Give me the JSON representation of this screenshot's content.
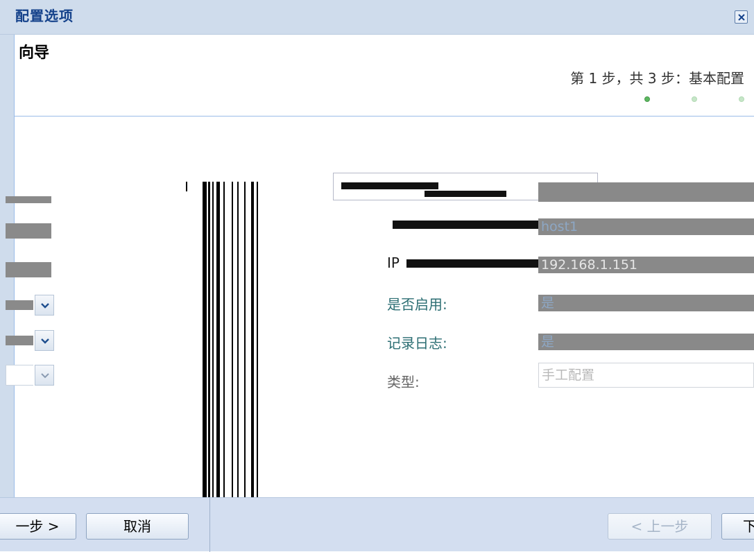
{
  "window": {
    "title": "配置选项",
    "close_icon": "close-icon"
  },
  "wizard": {
    "title": "向导",
    "step_text": "第 1 步，共 3 步：基本配置",
    "steps_total": 3,
    "current_step": 1
  },
  "form": {
    "fields": [
      {
        "label": "",
        "value": "host1"
      },
      {
        "label": "IP",
        "value": "192.168.1.151"
      },
      {
        "label": "是否启用:",
        "value": "是"
      },
      {
        "label": "记录日志:",
        "value": "是"
      },
      {
        "label": "类型:",
        "value": "手工配置"
      }
    ]
  },
  "footer": {
    "left_next_label": "一步 >",
    "left_cancel_label": "取消",
    "prev_label": "< 上一步",
    "next_label": "下"
  },
  "colors": {
    "titlebar": "#cfdcec",
    "title_text": "#15428b",
    "footer": "#d3def0",
    "label_teal": "#2c6e73",
    "step_dot_active": "#5cb860",
    "step_dot_inactive": "#c6e6c8"
  }
}
